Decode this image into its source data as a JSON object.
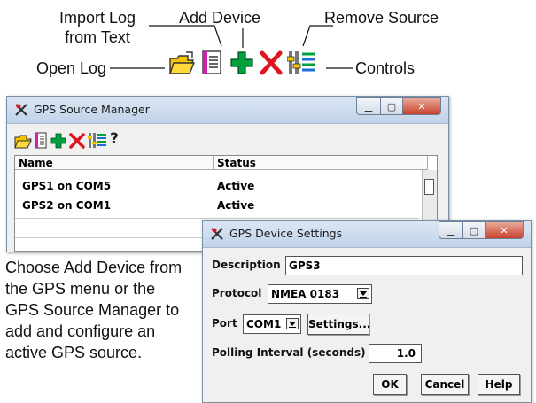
{
  "callouts": {
    "import_log": "Import Log\nfrom Text",
    "add_device": "Add Device",
    "remove_source": "Remove Source",
    "open_log": "Open Log",
    "controls": "Controls"
  },
  "icons": [
    "open-log-icon",
    "import-log-icon",
    "add-device-icon",
    "remove-source-icon",
    "controls-icon",
    "help-icon"
  ],
  "source_manager": {
    "title": "GPS Source Manager",
    "columns": [
      "Name",
      "Status"
    ],
    "rows": [
      {
        "name": "GPS1 on COM5",
        "status": "Active"
      },
      {
        "name": "GPS2 on COM1",
        "status": "Active"
      }
    ],
    "help_glyph": "?"
  },
  "device_settings": {
    "title": "GPS Device Settings",
    "description_label": "Description",
    "description_value": "GPS3",
    "protocol_label": "Protocol",
    "protocol_value": "NMEA 0183",
    "port_label": "Port",
    "port_value": "COM1",
    "settings_button": "Settings...",
    "polling_label": "Polling Interval (seconds)",
    "polling_value": "1.0",
    "ok_button": "OK",
    "cancel_button": "Cancel",
    "help_button": "Help"
  },
  "description_text": "Choose Add Device from the GPS menu or the GPS Source Manager to add and configure an active GPS source.",
  "colors": {
    "add_green": "#00a03c",
    "remove_red": "#e0141e",
    "folder_yellow": "#f2c500",
    "title_bar": "#c1d3ea"
  }
}
